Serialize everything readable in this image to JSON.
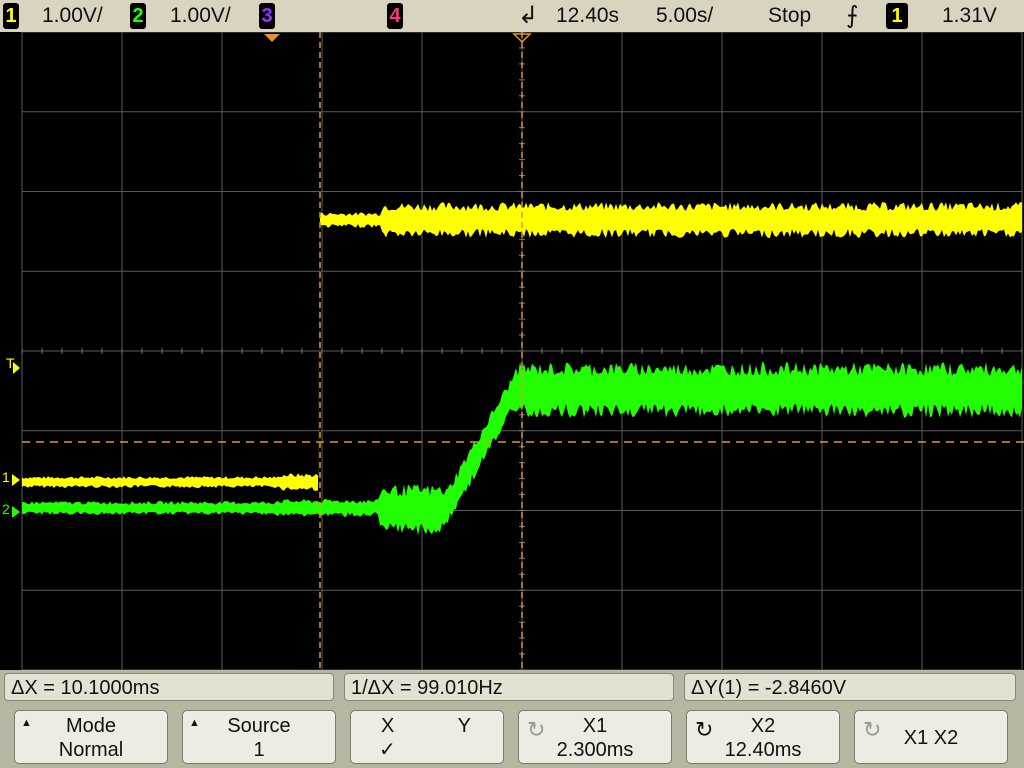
{
  "colors": {
    "ch1": "#ffff00",
    "ch2": "#22ff00",
    "ch3": "#9b30ff",
    "ch4": "#ff3377",
    "cursor": "#e0952d",
    "grid": "#6b6b6b",
    "bar_bg": "#d9d4bf"
  },
  "status_bar": {
    "ch1_num": "1",
    "ch1_scale": "1.00V/",
    "ch2_num": "2",
    "ch2_scale": "1.00V/",
    "ch3_num": "3",
    "ch4_num": "4",
    "time_ref_icon": "delay-arrow-icon",
    "delay": "12.40s",
    "timebase": "5.00s/",
    "run_state": "Stop",
    "trigger_edge_icon": "rising-edge-icon",
    "trigger_source": "1",
    "trigger_level": "1.31V"
  },
  "screen": {
    "trigger_marker": "T",
    "ch1_marker": "1",
    "ch2_marker": "2"
  },
  "measurements": {
    "delta_x": "ΔX = 10.1000ms",
    "inv_delta_x": "1/ΔX = 99.010Hz",
    "delta_y": "ΔY(1) = -2.8460V"
  },
  "softkeys": [
    {
      "line1": "Mode",
      "line2": "Normal"
    },
    {
      "line1": "Source",
      "line2": "1"
    },
    {
      "line1": "X",
      "line1b": "Y",
      "line2": "✓"
    },
    {
      "line1": "X1",
      "line2": "2.300ms"
    },
    {
      "line1": "X2",
      "line2": "12.40ms"
    },
    {
      "line1": "X1 X2",
      "line2": ""
    }
  ]
}
